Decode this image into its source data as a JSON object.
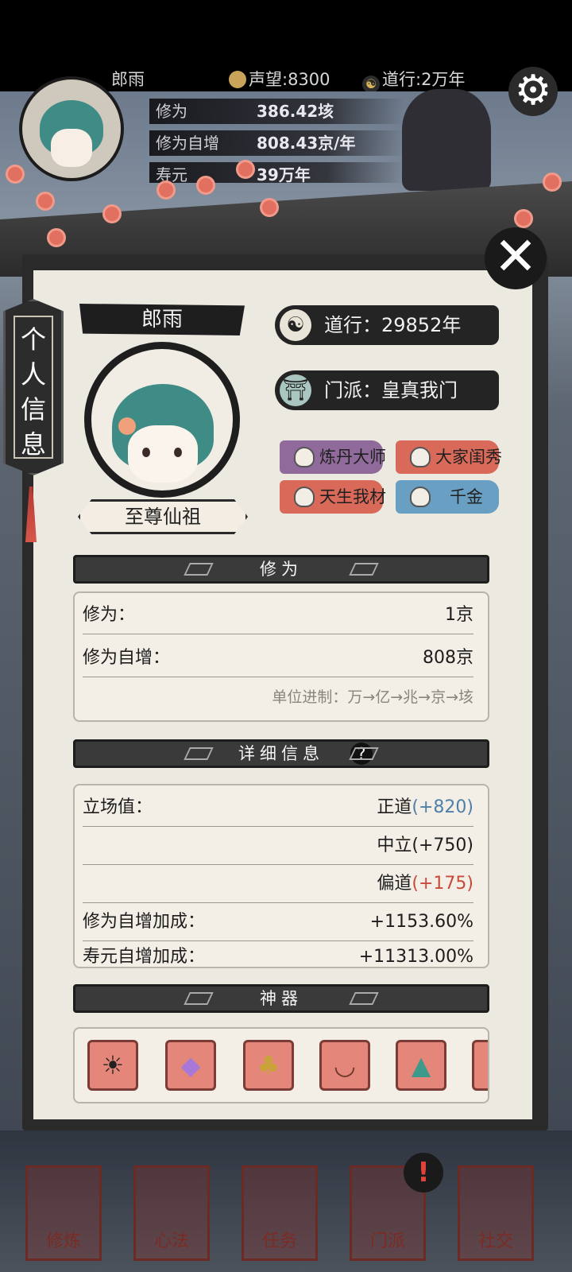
{
  "topbar": {
    "player_name": "郎雨",
    "reputation_label": "声望:8300",
    "daoxing_label": "道行:2万年"
  },
  "top_stats": [
    {
      "label": "修为",
      "value": "386.42垓"
    },
    {
      "label": "修为自增",
      "value": "808.43京/年"
    },
    {
      "label": "寿元",
      "value": "39万年"
    }
  ],
  "panel": {
    "side_tab": "个人信息",
    "close_symbol": "✕",
    "name": "郎雨",
    "rank_title": "至尊仙祖",
    "daoxing": "道行：29852年",
    "sect": "门派：皇真我门",
    "tags": [
      {
        "label": "炼丹大师",
        "color": "#8f6a9a"
      },
      {
        "label": "大家闺秀",
        "color": "#d96a5a"
      },
      {
        "label": "天生我材",
        "color": "#d96a5a"
      },
      {
        "label": "千金",
        "color": "#6a9fc4"
      }
    ]
  },
  "cultivation": {
    "header": "修为",
    "rows": [
      {
        "label": "修为：",
        "value": "1京"
      },
      {
        "label": "修为自增：",
        "value": "808京"
      }
    ],
    "unit_note": "单位进制：万→亿→兆→京→垓"
  },
  "details": {
    "header": "详细信息",
    "help_symbol": "?",
    "stance_label": "立场值：",
    "stances": [
      {
        "name": "正道",
        "value": "(+820)",
        "color": "#4e7fa8"
      },
      {
        "name": "中立",
        "value": "(+750)",
        "color": "#1d1d1d"
      },
      {
        "name": "偏道",
        "value": "(+175)",
        "color": "#c94a3b"
      }
    ],
    "bonus_label": "修为自增加成：",
    "bonus_value": "+1153.60%",
    "partial_label": "寿元自增加成：",
    "partial_value": "+11313.00%"
  },
  "artifacts": {
    "header": "神器",
    "items": [
      {
        "icon": "sun-disc-icon",
        "glyph": "☀"
      },
      {
        "icon": "crystal-icon",
        "glyph": "◆"
      },
      {
        "icon": "gold-tree-icon",
        "glyph": "♣"
      },
      {
        "icon": "bowl-icon",
        "glyph": "◡"
      },
      {
        "icon": "jade-seal-icon",
        "glyph": "▲"
      },
      {
        "icon": "scroll-icon",
        "glyph": "❀"
      }
    ]
  },
  "bottom_nav": [
    {
      "label": "修炼"
    },
    {
      "label": "心法"
    },
    {
      "label": "任务"
    },
    {
      "label": "门派"
    },
    {
      "label": "社交"
    }
  ],
  "notification_badge": "!"
}
